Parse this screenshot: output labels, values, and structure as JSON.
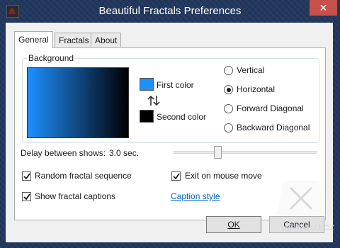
{
  "window": {
    "title": "Beautiful Fractals Preferences",
    "close_label": "✕"
  },
  "tabs": [
    {
      "label": "General",
      "active": true
    },
    {
      "label": "Fractals",
      "active": false
    },
    {
      "label": "About",
      "active": false
    }
  ],
  "background": {
    "group_label": "Background",
    "first_color_label": "First color",
    "second_color_label": "Second color",
    "first_color": "#1e90ff",
    "second_color": "#000000",
    "orientation_options": [
      {
        "label": "Vertical",
        "selected": false
      },
      {
        "label": "Horizontal",
        "selected": true
      },
      {
        "label": "Forward Diagonal",
        "selected": false
      },
      {
        "label": "Backward Diagonal",
        "selected": false
      }
    ]
  },
  "delay": {
    "label": "Delay between shows:",
    "value": "3.0 sec.",
    "slider_fraction": 0.3
  },
  "options": {
    "random_sequence": {
      "label": "Random fractal sequence",
      "checked": true
    },
    "exit_on_mouse": {
      "label": "Exit on mouse move",
      "checked": true
    },
    "show_captions": {
      "label": "Show fractal captions",
      "checked": true
    },
    "caption_style_link": "Caption style"
  },
  "buttons": {
    "ok": "OK",
    "cancel": "Cancel"
  },
  "watermark": {
    "text": "INSTALUJ.CZ"
  }
}
